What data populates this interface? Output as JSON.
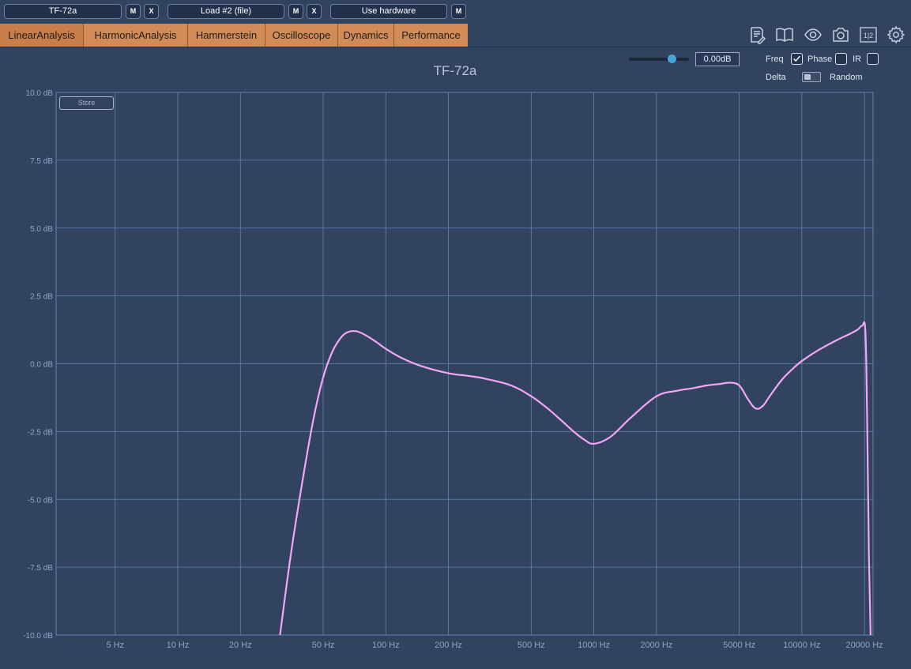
{
  "toolbar": {
    "slot1": {
      "name": "TF-72a",
      "m": "M",
      "x": "X"
    },
    "slot2": {
      "name": "Load #2 (file)",
      "m": "M",
      "x": "X"
    },
    "slot3": {
      "name": "Use hardware",
      "m": "M"
    }
  },
  "tabs": [
    {
      "label": "LinearAnalysis",
      "active": true
    },
    {
      "label": "HarmonicAnalysis"
    },
    {
      "label": "Hammerstein"
    },
    {
      "label": "Oscilloscope"
    },
    {
      "label": "Dynamics"
    },
    {
      "label": "Performance"
    }
  ],
  "tools": {
    "icons": [
      "notes-icon",
      "book-icon",
      "eye-icon",
      "camera-icon",
      "split-view-icon",
      "gear-icon"
    ],
    "split_label": "1|2"
  },
  "controls": {
    "gain_value": "0.00dB",
    "gain_slider_fraction": 0.72,
    "freq_label": "Freq",
    "freq_checked": true,
    "phase_label": "Phase",
    "phase_checked": false,
    "ir_label": "IR",
    "ir_checked": false,
    "delta_label": "Delta",
    "random_label": "Random"
  },
  "store_label": "Store",
  "colors": {
    "background": "#324360",
    "grid": "#5d86b0",
    "curve": "#f2a6f5",
    "tab": "#d28b57",
    "axis_text": "#8fa6c4"
  },
  "chart_data": {
    "type": "line",
    "title": "TF-72a",
    "x_scale": "log",
    "xlim": [
      2.6,
      22000
    ],
    "ylim": [
      -10,
      10
    ],
    "x_ticks": [
      5,
      10,
      20,
      50,
      100,
      200,
      500,
      1000,
      2000,
      5000,
      10000,
      20000
    ],
    "x_tick_labels": [
      "5 Hz",
      "10 Hz",
      "20 Hz",
      "50 Hz",
      "100 Hz",
      "200 Hz",
      "500 Hz",
      "1000 Hz",
      "2000 Hz",
      "5000 Hz",
      "10000 Hz",
      "20000 Hz"
    ],
    "y_ticks": [
      10,
      7.5,
      5,
      2.5,
      0,
      -2.5,
      -5,
      -7.5,
      -10
    ],
    "y_tick_labels": [
      "10.0 dB",
      "7.5 dB",
      "5.0 dB",
      "2.5 dB",
      "0.0 dB",
      "-2.5 dB",
      "-5.0 dB",
      "-7.5 dB",
      "-10.0 dB"
    ],
    "grid": true,
    "series": [
      {
        "x": [
          31,
          35,
          40,
          45,
          50,
          55,
          60,
          65,
          72,
          80,
          90,
          100,
          120,
          150,
          200,
          250,
          300,
          400,
          500,
          600,
          700,
          800,
          900,
          1000,
          1200,
          1500,
          2000,
          2500,
          3000,
          3500,
          4000,
          4500,
          5000,
          5500,
          6000,
          6500,
          7000,
          8000,
          9000,
          10000,
          12000,
          15000,
          17000,
          18500,
          19500,
          20200,
          20600,
          21000,
          21400
        ],
        "y": [
          -10,
          -7.0,
          -4.2,
          -2.0,
          -0.5,
          0.4,
          0.9,
          1.15,
          1.2,
          1.05,
          0.8,
          0.55,
          0.2,
          -0.1,
          -0.35,
          -0.45,
          -0.55,
          -0.8,
          -1.2,
          -1.65,
          -2.1,
          -2.5,
          -2.8,
          -2.95,
          -2.7,
          -2.0,
          -1.2,
          -1.0,
          -0.9,
          -0.8,
          -0.75,
          -0.7,
          -0.8,
          -1.3,
          -1.65,
          -1.55,
          -1.2,
          -0.6,
          -0.2,
          0.1,
          0.5,
          0.9,
          1.1,
          1.25,
          1.4,
          1.2,
          -2.0,
          -7.0,
          -10
        ]
      }
    ]
  }
}
